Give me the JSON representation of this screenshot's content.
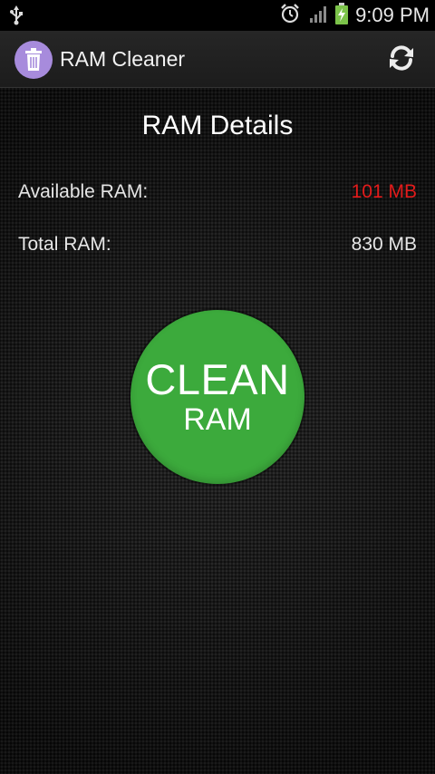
{
  "status_bar": {
    "time": "9:09 PM",
    "icons": [
      "usb-icon",
      "alarm-icon",
      "signal-icon",
      "battery-charging-icon"
    ]
  },
  "action_bar": {
    "app_icon": "trash-can-icon",
    "title": "RAM Cleaner",
    "refresh_icon": "refresh-icon"
  },
  "main": {
    "section_title": "RAM Details",
    "available_label": "Available RAM:",
    "available_value": "101 MB",
    "total_label": "Total RAM:",
    "total_value": "830 MB",
    "clean_button": {
      "line1": "CLEAN",
      "line2": "RAM"
    }
  },
  "colors": {
    "accent_green": "#3caa3c",
    "available_value": "#e31b1b",
    "app_icon_bg": "#a78bdc"
  }
}
